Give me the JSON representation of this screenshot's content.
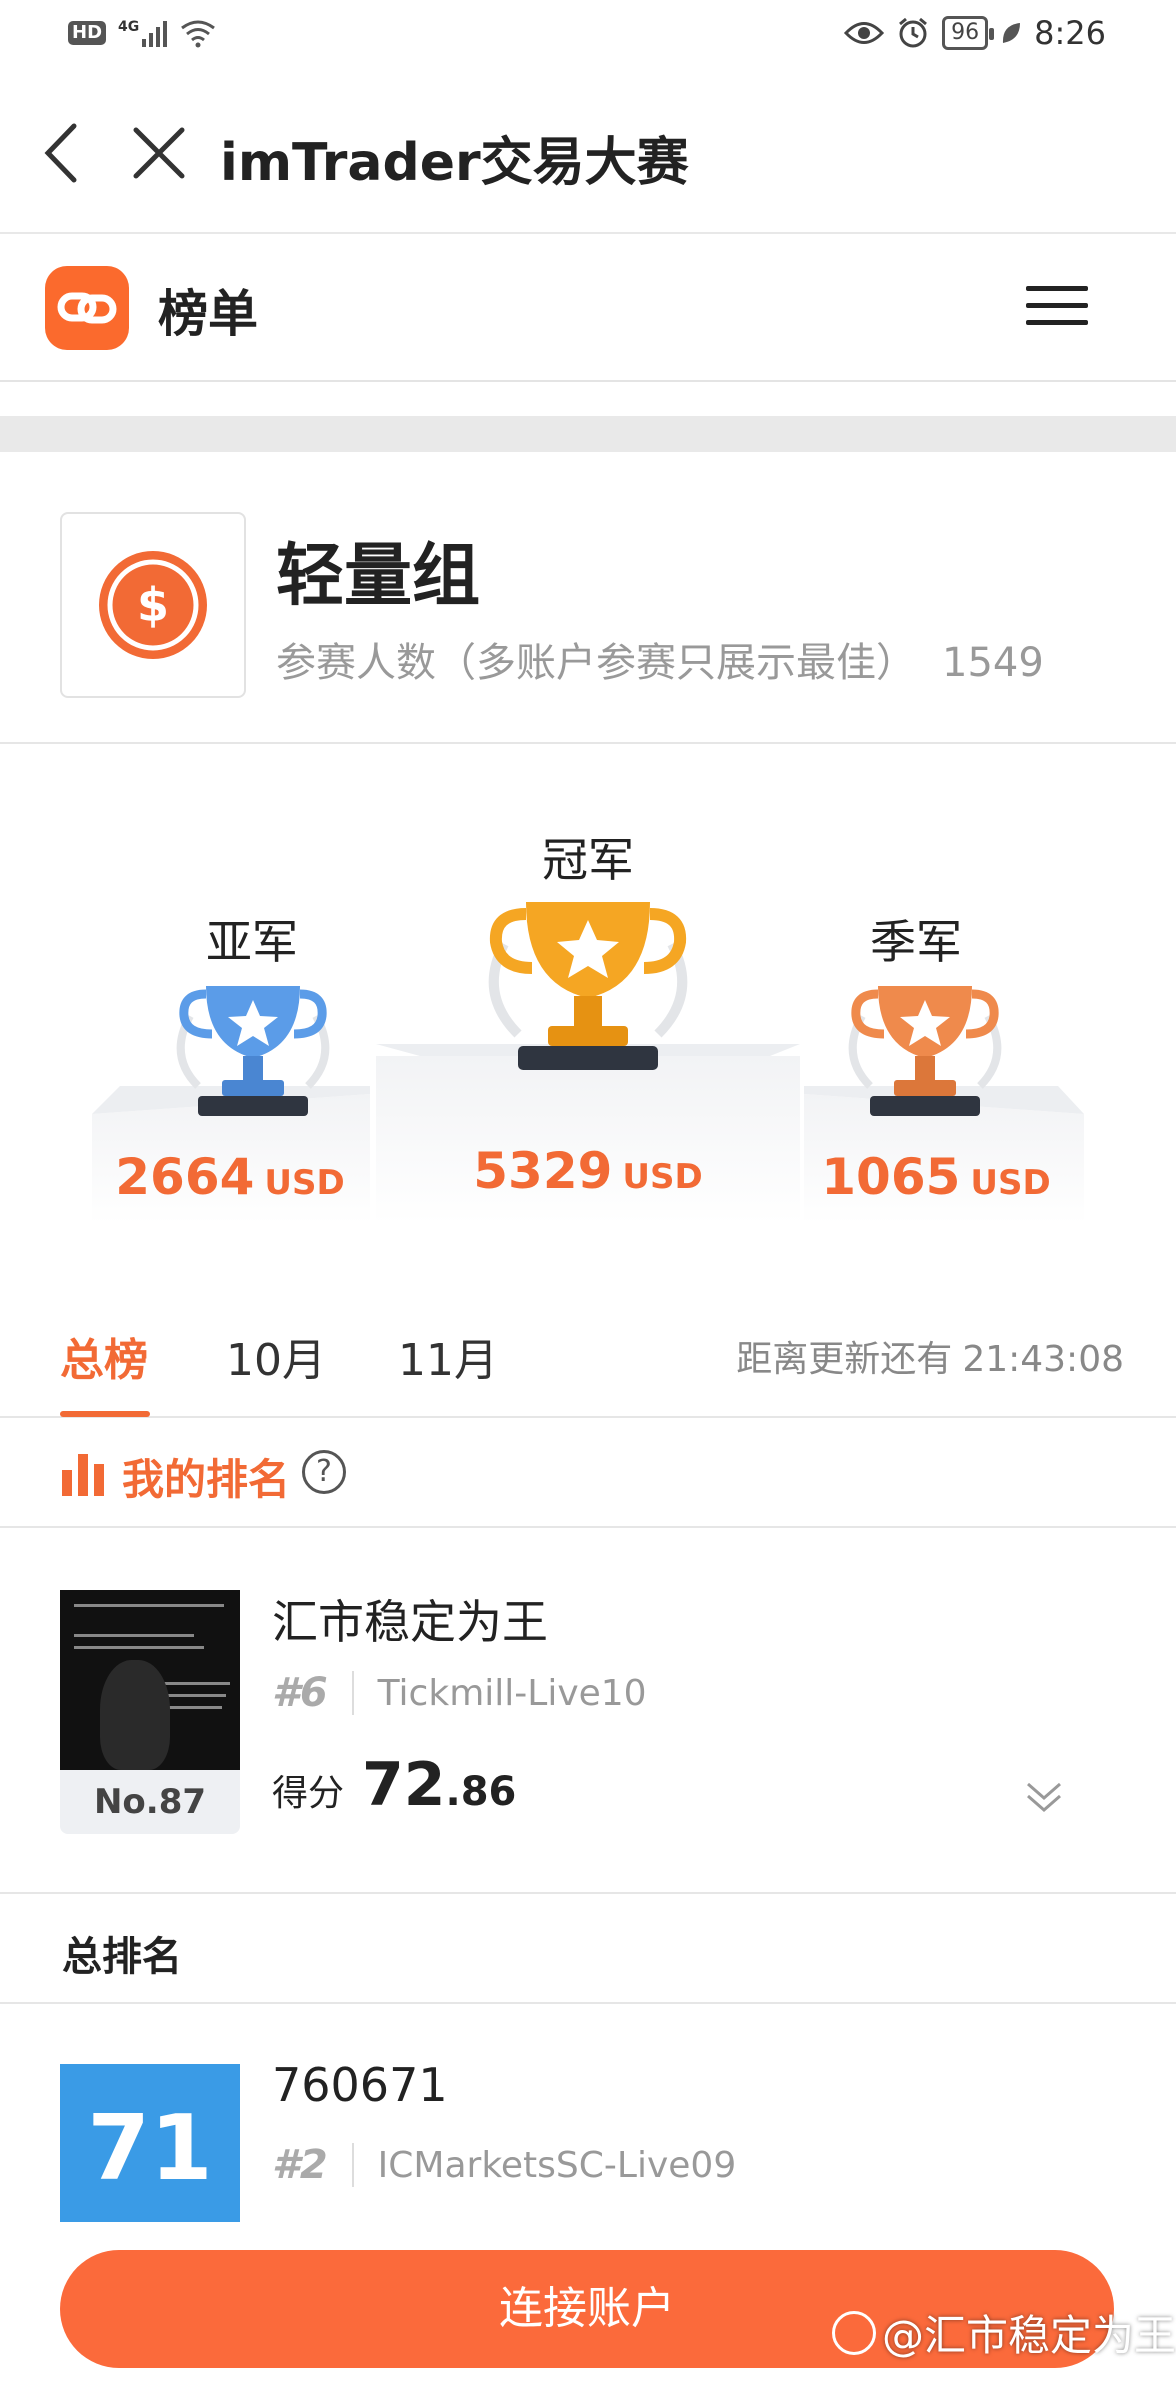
{
  "status_bar": {
    "network": "HD",
    "signal": "4G",
    "battery": "96",
    "time": "8:26"
  },
  "titlebar": {
    "title": "imTrader交易大赛"
  },
  "site_header": {
    "title": "榜单"
  },
  "group": {
    "title": "轻量组",
    "participants_label": "参赛人数（多账户参赛只展示最佳）",
    "participants_count": "1549"
  },
  "podium": {
    "first": {
      "label": "冠军",
      "amount": "5329",
      "unit": "USD"
    },
    "second": {
      "label": "亚军",
      "amount": "2664",
      "unit": "USD"
    },
    "third": {
      "label": "季军",
      "amount": "1065",
      "unit": "USD"
    }
  },
  "tabs": [
    {
      "label": "总榜",
      "active": true
    },
    {
      "label": "10月",
      "active": false
    },
    {
      "label": "11月",
      "active": false
    }
  ],
  "countdown": {
    "label": "距离更新还有",
    "time": "21:43:08"
  },
  "my_rank": {
    "title": "我的排名",
    "help": "?",
    "name": "汇市稳定为王",
    "position": "#6",
    "server": "Tickmill-Live10",
    "rank_badge": "No.87",
    "score_label": "得分",
    "score_int": "72",
    "score_dec": ".86"
  },
  "total_rank": {
    "title": "总排名",
    "entries": [
      {
        "score": "71",
        "name": "760671",
        "position": "#2",
        "server": "ICMarketsSC-Live09"
      }
    ]
  },
  "bottom": {
    "connect_label": "连接账户"
  },
  "watermark": {
    "text": "@汇市稳定为王"
  },
  "colors": {
    "accent": "#f26a35",
    "button": "#fb6a3b",
    "score_box": "#3a9be6",
    "gold": "#f5a623",
    "silver_blue": "#5b9ce8",
    "bronze": "#ef8a4c"
  }
}
